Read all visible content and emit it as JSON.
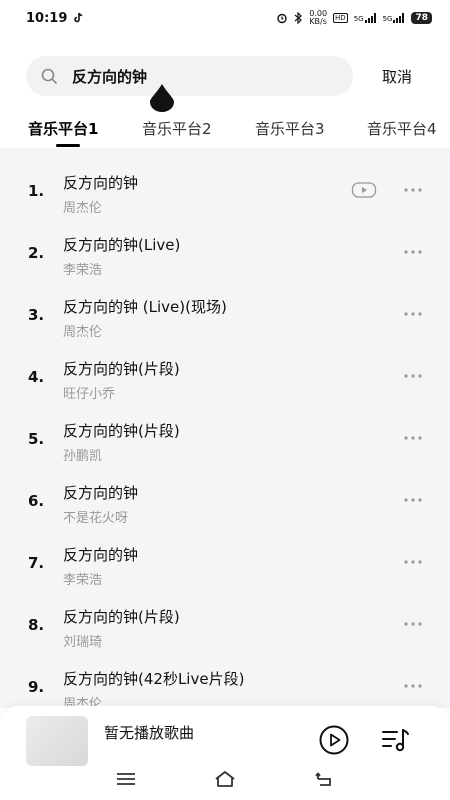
{
  "status": {
    "time": "10:19",
    "net_speed": "0.00\nKB/s",
    "net_speed_line1": "0.00",
    "net_speed_line2": "KB/s",
    "hd": "HD",
    "sig1": "5G",
    "sig2": "5G",
    "battery": "78"
  },
  "search": {
    "query": "反方向的钟",
    "cancel_label": "取消"
  },
  "tabs": [
    {
      "label": "音乐平台1",
      "active": true
    },
    {
      "label": "音乐平台2",
      "active": false
    },
    {
      "label": "音乐平台3",
      "active": false
    },
    {
      "label": "音乐平台4",
      "active": false
    }
  ],
  "songs": [
    {
      "index": "1.",
      "title": "反方向的钟",
      "artist": "周杰伦",
      "has_video": true
    },
    {
      "index": "2.",
      "title": "反方向的钟(Live)",
      "artist": "李荣浩",
      "has_video": false
    },
    {
      "index": "3.",
      "title": "反方向的钟 (Live)(现场)",
      "artist": "周杰伦",
      "has_video": false
    },
    {
      "index": "4.",
      "title": "反方向的钟(片段)",
      "artist": "旺仔小乔",
      "has_video": false
    },
    {
      "index": "5.",
      "title": "反方向的钟(片段)",
      "artist": "孙鹏凯",
      "has_video": false
    },
    {
      "index": "6.",
      "title": "反方向的钟",
      "artist": "不是花火呀",
      "has_video": false
    },
    {
      "index": "7.",
      "title": "反方向的钟",
      "artist": "李荣浩",
      "has_video": false
    },
    {
      "index": "8.",
      "title": "反方向的钟(片段)",
      "artist": "刘瑞琦",
      "has_video": false
    },
    {
      "index": "9.",
      "title": "反方向的钟(42秒Live片段)",
      "artist": "周杰伦",
      "has_video": false
    }
  ],
  "player": {
    "now_playing": "暂无播放歌曲"
  },
  "icons": {
    "search": "search-icon",
    "more": "more-icon",
    "video": "video-icon",
    "play": "play-icon",
    "playlist": "playlist-icon",
    "nav_menu": "menu-icon",
    "nav_home": "home-icon",
    "nav_back": "back-icon"
  }
}
